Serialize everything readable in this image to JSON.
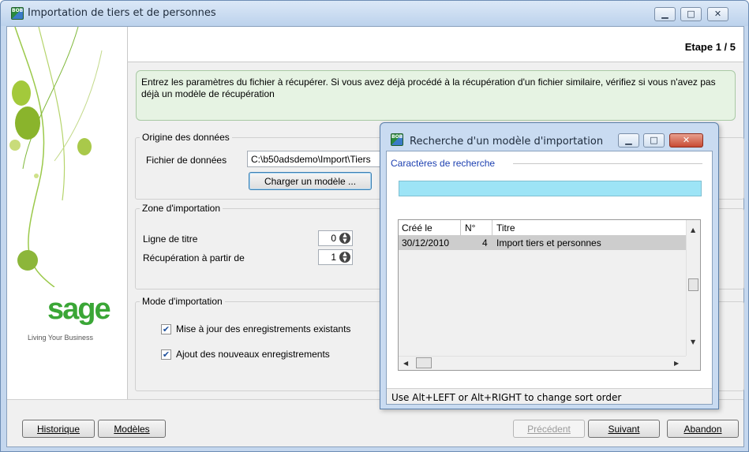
{
  "window": {
    "title": "Importation de tiers et de personnes"
  },
  "header": {
    "etape": "Etape  1 / 5"
  },
  "info": "Entrez les paramètres du fichier à récupérer. Si vous avez déjà procédé à la récupération d'un fichier similaire, vérifiez si vous n'avez pas déjà un modèle de récupération",
  "origine": {
    "legend": "Origine des données",
    "fichier_label": "Fichier de données",
    "fichier_value": "C:\\b50adsdemo\\Import\\Tiers",
    "charger_button": "Charger un modèle ..."
  },
  "zone": {
    "legend": "Zone d'importation",
    "ligne_label": "Ligne de titre",
    "ligne_value": "0",
    "recup_label": "Récupération à partir de",
    "recup_value": "1"
  },
  "mode": {
    "legend": "Mode d'importation",
    "maj_label": "Mise à jour des enregistrements existants",
    "maj_checked": true,
    "ajout_label": "Ajout des nouveaux enregistrements",
    "ajout_checked": true
  },
  "sidebar": {
    "logo": "sage",
    "tagline": "Living Your Business"
  },
  "footer": {
    "historique": "Historique",
    "modeles": "Modèles",
    "precedent": "Précédent",
    "suivant": "Suivant",
    "abandon": "Abandon"
  },
  "dialog": {
    "title": "Recherche d'un modèle d'importation",
    "search_legend": "Caractères de recherche",
    "search_value": "",
    "columns": [
      "Créé le",
      "N°",
      "Titre"
    ],
    "rows": [
      {
        "cree_le": "30/12/2010",
        "numero": "4",
        "titre": "Import tiers et personnes"
      }
    ],
    "status": "Use Alt+LEFT or Alt+RIGHT to change sort order"
  },
  "colors": {
    "accent_blue": "#1c4f9c",
    "search_field": "#9de4f6",
    "info_box": "#e6f3e3",
    "sage_green": "#3aa636"
  }
}
